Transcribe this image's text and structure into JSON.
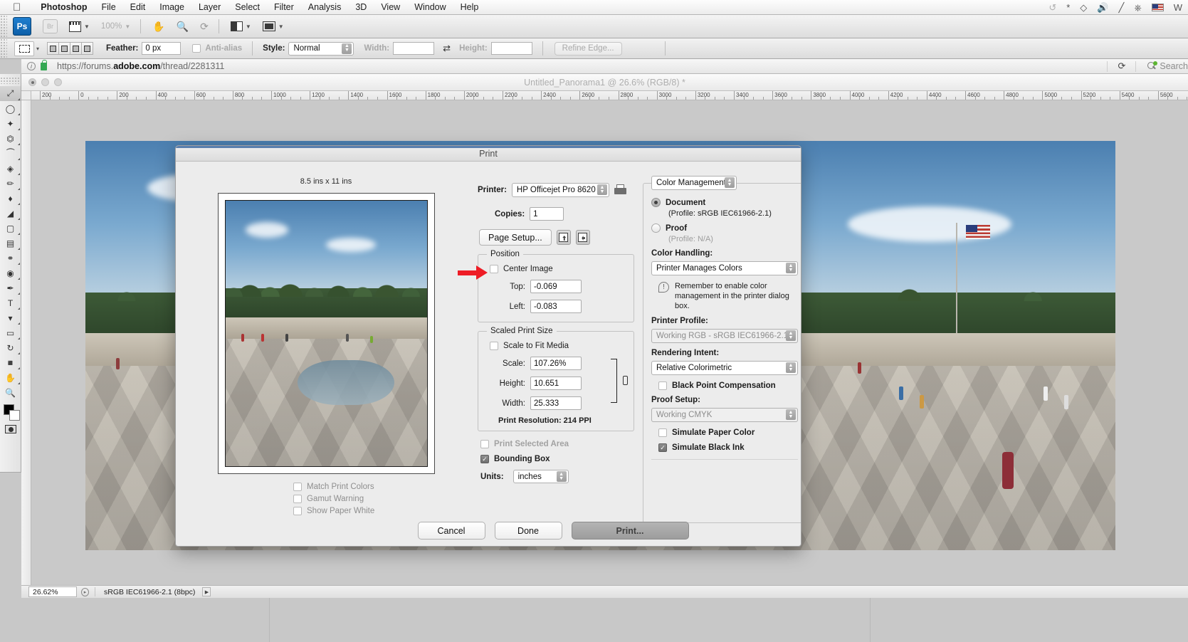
{
  "menubar": {
    "apple_icon": "apple-icon",
    "items": [
      "Photoshop",
      "File",
      "Edit",
      "Image",
      "Layer",
      "Select",
      "Filter",
      "Analysis",
      "3D",
      "View",
      "Window",
      "Help"
    ],
    "status_icons": [
      "time-machine-icon",
      "bluetooth-icon",
      "wifi-icon",
      "volume-icon",
      "pencil-icon",
      "eject-icon",
      "us-flag-icon",
      "spotlight-icon"
    ]
  },
  "app_toolbar": {
    "logo": "Ps",
    "bridge_label": "Br",
    "zoom_level": "100%",
    "icons": [
      "film-strip-icon",
      "hand-tool-icon",
      "zoom-tool-icon",
      "rotate-view-icon",
      "arrange-documents-icon",
      "screen-mode-icon"
    ]
  },
  "options_bar": {
    "tool": "rectangular-marquee",
    "feather_label": "Feather:",
    "feather_value": "0 px",
    "antialias_label": "Anti-alias",
    "style_label": "Style:",
    "style_value": "Normal",
    "width_label": "Width:",
    "width_value": "",
    "height_label": "Height:",
    "height_value": "",
    "refine_edge_label": "Refine Edge..."
  },
  "browser": {
    "url_prefix": "https://forums.",
    "url_bold": "adobe.com",
    "url_suffix": "/thread/2281311",
    "reload_icon": "reload-icon",
    "search_placeholder": "Search"
  },
  "document": {
    "title": "Untitled_Panorama1 @ 26.6% (RGB/8) *",
    "ruler_ticks": [
      "200",
      "0",
      "200",
      "400",
      "600",
      "800",
      "1000",
      "1200",
      "1400",
      "1600",
      "1800",
      "2000",
      "2200",
      "2400",
      "2600",
      "2800",
      "3000",
      "3200",
      "3400",
      "3600",
      "3800",
      "4000",
      "4200",
      "4400",
      "4600",
      "4800",
      "5000",
      "5200",
      "5400",
      "5600"
    ]
  },
  "print_dialog": {
    "title": "Print",
    "paper_size_label": "8.5 ins x 11 ins",
    "printer_label": "Printer:",
    "printer_value": "HP Officejet Pro 8620",
    "copies_label": "Copies:",
    "copies_value": "1",
    "page_setup_label": "Page Setup...",
    "orientation_portrait_icon": "portrait-orientation-icon",
    "orientation_landscape_icon": "landscape-orientation-icon",
    "printer_settings_icon": "printer-settings-icon",
    "position": {
      "group_title": "Position",
      "center_image_label": "Center Image",
      "center_image_checked": false,
      "top_label": "Top:",
      "top_value": "-0.069",
      "left_label": "Left:",
      "left_value": "-0.083"
    },
    "scaled_print_size": {
      "group_title": "Scaled Print Size",
      "scale_to_fit_label": "Scale to Fit Media",
      "scale_to_fit_checked": false,
      "scale_label": "Scale:",
      "scale_value": "107.26%",
      "height_label": "Height:",
      "height_value": "10.651",
      "width_label": "Width:",
      "width_value": "25.333",
      "print_resolution": "Print Resolution: 214 PPI"
    },
    "print_selected_area_label": "Print Selected Area",
    "print_selected_area_checked": false,
    "bounding_box_label": "Bounding Box",
    "bounding_box_checked": true,
    "units_label": "Units:",
    "units_value": "inches",
    "preview_options": [
      {
        "label": "Match Print Colors",
        "checked": false
      },
      {
        "label": "Gamut Warning",
        "checked": false
      },
      {
        "label": "Show Paper White",
        "checked": false
      }
    ],
    "color_management": {
      "popup_value": "Color Management",
      "document_label": "Document",
      "document_selected": true,
      "document_profile": "(Profile: sRGB IEC61966-2.1)",
      "proof_label": "Proof",
      "proof_selected": false,
      "proof_profile": "(Profile: N/A)",
      "color_handling_label": "Color Handling:",
      "color_handling_value": "Printer Manages Colors",
      "warning_icon": "warning-icon",
      "warning_text": "Remember to enable color management in the printer dialog box.",
      "printer_profile_label": "Printer Profile:",
      "printer_profile_value": "Working RGB - sRGB IEC61966-2.1",
      "rendering_intent_label": "Rendering Intent:",
      "rendering_intent_value": "Relative Colorimetric",
      "black_point_label": "Black Point Compensation",
      "black_point_checked": false,
      "proof_setup_label": "Proof Setup:",
      "proof_setup_value": "Working CMYK",
      "simulate_paper_label": "Simulate Paper Color",
      "simulate_paper_checked": false,
      "simulate_black_label": "Simulate Black Ink",
      "simulate_black_checked": true
    },
    "buttons": {
      "cancel": "Cancel",
      "done": "Done",
      "print": "Print..."
    }
  },
  "tool_palette": {
    "tools": [
      "move-tool",
      "lasso-tool",
      "magic-wand-tool",
      "crop-tool",
      "eyedropper-tool",
      "spot-healing-tool",
      "brush-tool",
      "clone-stamp-tool",
      "history-brush-tool",
      "eraser-tool",
      "gradient-tool",
      "blur-tool",
      "dodge-tool",
      "pen-tool",
      "type-tool",
      "path-selection-tool",
      "shape-tool",
      "3d-rotate-tool",
      "3d-camera-tool",
      "hand-tool",
      "zoom-tool"
    ],
    "foreground_color": "#000000",
    "background_color": "#ffffff",
    "quick_mask_icon": "quick-mask-icon"
  },
  "status_bar": {
    "zoom_value": "26.62%",
    "doc_icon": "document-icon",
    "profile_text": "sRGB IEC61966-2.1 (8bpc)",
    "expand_icon": "expand-arrow-icon"
  },
  "colors": {
    "accent": "#5a7fae",
    "annotation_red": "#ee1c25",
    "window_bg": "#ececec",
    "canvas_bg": "#c9c9c9"
  }
}
